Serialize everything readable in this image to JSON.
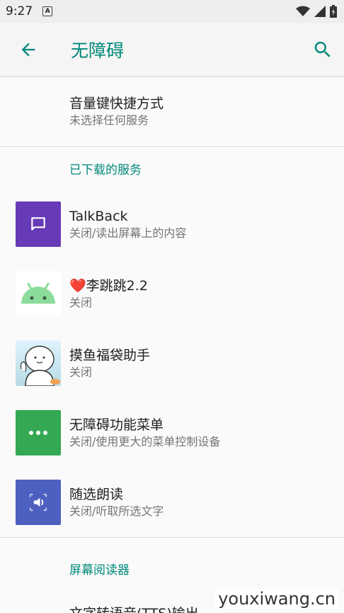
{
  "status_bar": {
    "time": "9:27",
    "notif_letter": "A"
  },
  "app_bar": {
    "title": "无障碍"
  },
  "volume_shortcut": {
    "title": "音量键快捷方式",
    "summary": "未选择任何服务"
  },
  "downloaded_section": {
    "header": "已下载的服务"
  },
  "services": [
    {
      "title": "TalkBack",
      "summary": "关闭/读出屏幕上的内容"
    },
    {
      "title": "❤️李跳跳2.2",
      "summary": "关闭"
    },
    {
      "title": "摸鱼福袋助手",
      "summary": "关闭"
    },
    {
      "title": "无障碍功能菜单",
      "summary": "关闭/使用更大的菜单控制设备"
    },
    {
      "title": "随选朗读",
      "summary": "关闭/听取所选文字"
    }
  ],
  "screen_reader_section": {
    "header": "屏幕阅读器"
  },
  "next_item_partial": "文字转语音(TTS)输出",
  "watermark": "youxiwang.cn",
  "colors": {
    "accent": "#00897b",
    "talkback": "#673ab7",
    "menu": "#34a853",
    "select_to_speak": "#4d5fbf"
  }
}
